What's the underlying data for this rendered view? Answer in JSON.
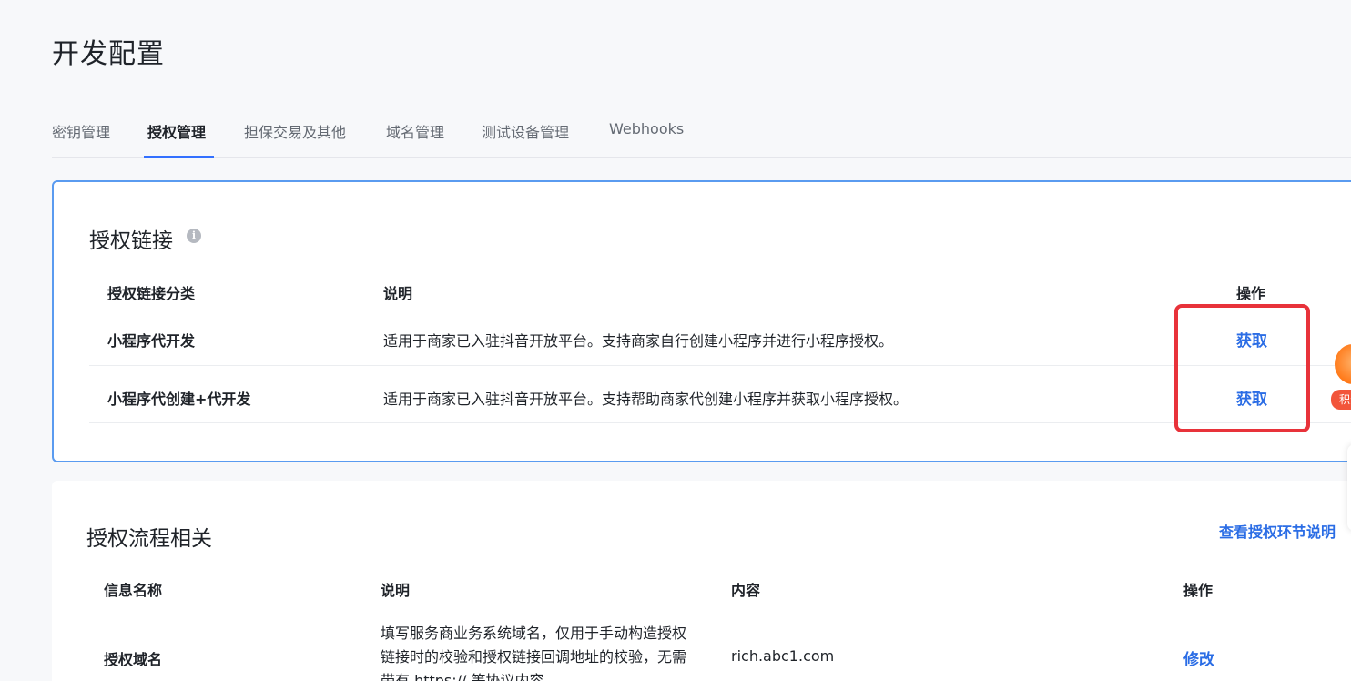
{
  "page_title": "开发配置",
  "tabs": [
    {
      "label": "密钥管理"
    },
    {
      "label": "授权管理",
      "active": true
    },
    {
      "label": "担保交易及其他"
    },
    {
      "label": "域名管理"
    },
    {
      "label": "测试设备管理"
    },
    {
      "label": "Webhooks"
    }
  ],
  "auth_links": {
    "title": "授权链接",
    "info_icon": "i",
    "headers": {
      "category": "授权链接分类",
      "desc": "说明",
      "action": "操作"
    },
    "rows": [
      {
        "category": "小程序代开发",
        "desc": "适用于商家已入驻抖音开放平台。支持商家自行创建小程序并进行小程序授权。",
        "action": "获取"
      },
      {
        "category": "小程序代创建+代开发",
        "desc": "适用于商家已入驻抖音开放平台。支持帮助商家代创建小程序并获取小程序授权。",
        "action": "获取"
      }
    ]
  },
  "auth_flow": {
    "title": "授权流程相关",
    "header_link": "查看授权环节说明",
    "headers": {
      "name": "信息名称",
      "desc": "说明",
      "content": "内容",
      "action": "操作"
    },
    "rows": [
      {
        "name": "授权域名",
        "desc": "填写服务商业务系统域名，仅用于手动构造授权链接时的校验和授权链接回调地址的校验，无需带有 https:// 等协议内容",
        "content": "rich.abc1.com",
        "action": "修改"
      }
    ]
  },
  "floating": {
    "label": "积分"
  },
  "colors": {
    "accent": "#3370ff",
    "link": "#2b6de5",
    "highlight": "#e8323a",
    "card_border": "#5a9bf0"
  }
}
